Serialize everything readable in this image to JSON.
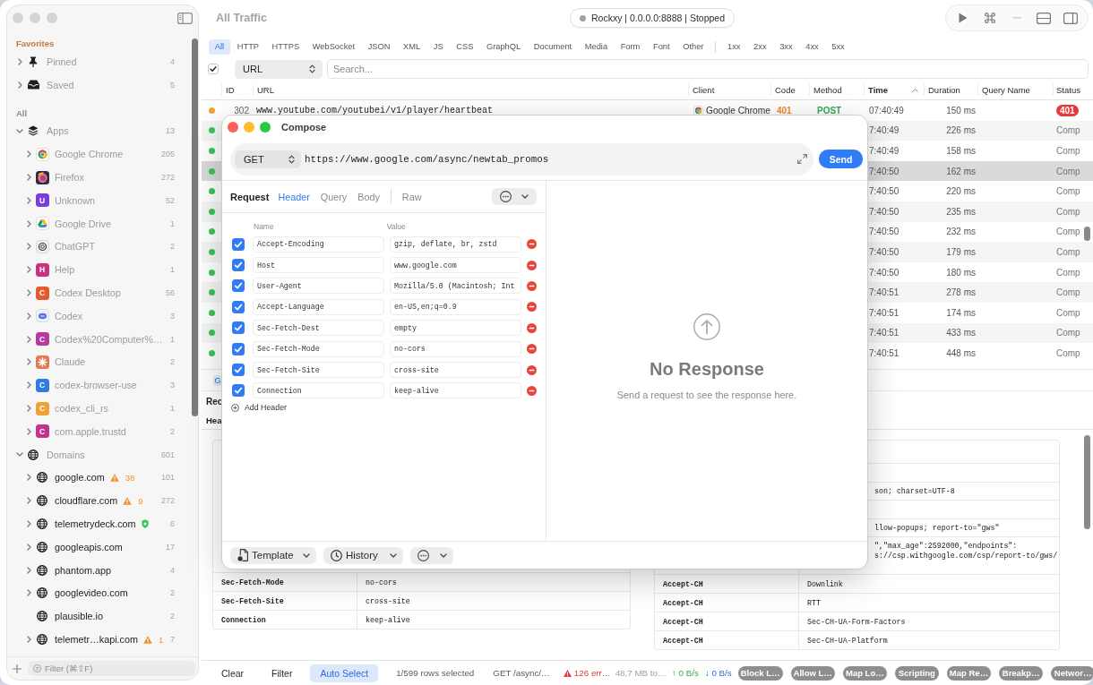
{
  "window": {
    "title": "All Traffic",
    "focused": false
  },
  "sidebar": {
    "sections": [
      {
        "title": "Favorites",
        "kind": "favorites",
        "items": [
          {
            "label": "Pinned",
            "count": "4",
            "kind": "pinned",
            "expanded": false
          },
          {
            "label": "Saved",
            "count": "5",
            "kind": "saved",
            "expanded": false
          }
        ]
      },
      {
        "title": "All",
        "kind": "all",
        "items": [
          {
            "label": "Apps",
            "count": "13",
            "kind": "apps",
            "expanded": true,
            "children": [
              {
                "label": "Google Chrome",
                "count": "205",
                "kind": "ring-logo",
                "expanded": false
              },
              {
                "label": "Firefox",
                "count": "272",
                "kind": "disc-logo",
                "expanded": false
              },
              {
                "label": "Unknown",
                "count": "52",
                "kind": "letter",
                "letter": "U",
                "color": "#7b3dd8",
                "expanded": false
              },
              {
                "label": "Google Drive",
                "count": "1",
                "kind": "triangle-logo",
                "expanded": false
              },
              {
                "label": "ChatGPT",
                "count": "2",
                "kind": "rings-logo",
                "expanded": false
              },
              {
                "label": "Help",
                "count": "1",
                "kind": "letter",
                "letter": "H",
                "color": "#c8327f",
                "expanded": false
              },
              {
                "label": "Codex Desktop",
                "count": "56",
                "kind": "letter",
                "letter": "C",
                "color": "#e5592c",
                "expanded": false
              },
              {
                "label": "Codex",
                "count": "3",
                "kind": "cloud-logo",
                "expanded": false
              },
              {
                "label": "Codex%20Computer%…",
                "count": "1",
                "kind": "letter",
                "letter": "C",
                "color": "#b8389f",
                "expanded": false
              },
              {
                "label": "Claude",
                "count": "2",
                "kind": "burst-logo",
                "expanded": false
              },
              {
                "label": "codex-browser-use",
                "count": "3",
                "kind": "letter",
                "letter": "C",
                "color": "#2f7ae3",
                "expanded": false
              },
              {
                "label": "codex_cli_rs",
                "count": "1",
                "kind": "letter",
                "letter": "C",
                "color": "#eea236",
                "expanded": false
              },
              {
                "label": "com.apple.trustd",
                "count": "2",
                "kind": "letter",
                "letter": "C",
                "color": "#c2338f",
                "expanded": false
              }
            ]
          },
          {
            "label": "Domains",
            "count": "601",
            "kind": "domains",
            "expanded": true,
            "children": [
              {
                "label": "google.com",
                "count": "101",
                "kind": "domain",
                "expanded": false,
                "alert": {
                  "kind": "warning",
                  "count": "38"
                }
              },
              {
                "label": "cloudflare.com",
                "count": "272",
                "kind": "domain",
                "expanded": false,
                "alert": {
                  "kind": "warning",
                  "count": "9"
                }
              },
              {
                "label": "telemetrydeck.com",
                "count": "6",
                "kind": "domain",
                "expanded": false,
                "alert": {
                  "kind": "shield"
                }
              },
              {
                "label": "googleapis.com",
                "count": "17",
                "kind": "domain",
                "expanded": false
              },
              {
                "label": "phantom.app",
                "count": "4",
                "kind": "domain",
                "expanded": false
              },
              {
                "label": "googlevideo.com",
                "count": "2",
                "kind": "domain",
                "expanded": false
              },
              {
                "label": "plausible.io",
                "count": "2",
                "kind": "domain"
              },
              {
                "label": "telemetr…kapi.com",
                "count": "7",
                "kind": "domain",
                "expanded": false,
                "alert": {
                  "kind": "warning",
                  "count": "1"
                }
              }
            ]
          }
        ]
      }
    ],
    "filter": {
      "placeholder": "Filter (⌘⇧F)"
    }
  },
  "proxy": {
    "text": "Rockxy | 0.0.0.0:8888 | Stopped",
    "running": false
  },
  "toolbar_actions": [
    {
      "kind": "play",
      "disabled": false
    },
    {
      "kind": "command",
      "disabled": false
    },
    {
      "kind": "minus",
      "disabled": true
    },
    {
      "kind": "split",
      "disabled": false
    },
    {
      "kind": "sidebar",
      "disabled": false
    }
  ],
  "type_filters": [
    {
      "label": "All",
      "selected": true
    },
    {
      "label": "HTTP",
      "selected": false
    },
    {
      "label": "HTTPS",
      "selected": false
    },
    {
      "label": "WebSocket",
      "selected": false
    },
    {
      "label": "JSON",
      "selected": false
    },
    {
      "label": "XML",
      "selected": false
    },
    {
      "label": "JS",
      "selected": false
    },
    {
      "label": "CSS",
      "selected": false
    },
    {
      "label": "GraphQL",
      "selected": false
    },
    {
      "label": "Document",
      "selected": false
    },
    {
      "label": "Media",
      "selected": false
    },
    {
      "label": "Form",
      "selected": false
    },
    {
      "label": "Font",
      "selected": false
    },
    {
      "label": "Other",
      "selected": false
    }
  ],
  "status_filters": [
    {
      "label": "1xx",
      "selected": false
    },
    {
      "label": "2xx",
      "selected": false
    },
    {
      "label": "3xx",
      "selected": false
    },
    {
      "label": "4xx",
      "selected": false
    },
    {
      "label": "5xx",
      "selected": false
    }
  ],
  "search": {
    "checked": true,
    "field": "URL",
    "placeholder": "Search..."
  },
  "table": {
    "columns": [
      {
        "label": "ID",
        "sorted": false
      },
      {
        "label": "URL",
        "sorted": false
      },
      {
        "label": "Client",
        "sorted": false
      },
      {
        "label": "Code",
        "sorted": false
      },
      {
        "label": "Method",
        "sorted": false
      },
      {
        "label": "Time",
        "sorted": true
      },
      {
        "label": "Duration",
        "sorted": false
      },
      {
        "label": "Query Name",
        "sorted": false
      },
      {
        "label": "Status",
        "sorted": false
      }
    ],
    "rows": [
      {
        "color": "#f5a13a",
        "id": "302",
        "url": "www.youtube.com/youtubei/v1/player/heartbeat",
        "client": "Google Chrome",
        "code": "401",
        "method": "POST",
        "time": "07:40:49",
        "duration": "150 ms",
        "status": "401",
        "kind": "error",
        "selected": false
      },
      {
        "color": "#3cc35a",
        "time": "7:40:49",
        "duration": "226 ms",
        "status": "Comp",
        "kind": "complete",
        "selected": false
      },
      {
        "color": "#3cc35a",
        "time": "7:40:49",
        "duration": "158 ms",
        "status": "Comp",
        "kind": "complete",
        "selected": false
      },
      {
        "color": "#3cc35a",
        "time": "7:40:50",
        "duration": "162 ms",
        "status": "Comp",
        "kind": "complete",
        "selected": true
      },
      {
        "color": "#3cc35a",
        "time": "7:40:50",
        "duration": "220 ms",
        "status": "Comp",
        "kind": "complete",
        "selected": false
      },
      {
        "color": "#3cc35a",
        "time": "7:40:50",
        "duration": "235 ms",
        "status": "Comp",
        "kind": "complete",
        "selected": false
      },
      {
        "color": "#3cc35a",
        "time": "7:40:50",
        "duration": "232 ms",
        "status": "Comp",
        "kind": "complete",
        "selected": false
      },
      {
        "color": "#3cc35a",
        "time": "7:40:50",
        "duration": "179 ms",
        "status": "Comp",
        "kind": "complete",
        "selected": false
      },
      {
        "color": "#3cc35a",
        "time": "7:40:50",
        "duration": "180 ms",
        "status": "Comp",
        "kind": "complete",
        "selected": false
      },
      {
        "color": "#3cc35a",
        "time": "7:40:51",
        "duration": "278 ms",
        "status": "Comp",
        "kind": "complete",
        "selected": false
      },
      {
        "color": "#3cc35a",
        "time": "7:40:51",
        "duration": "174 ms",
        "status": "Comp",
        "kind": "complete",
        "selected": false
      },
      {
        "color": "#3cc35a",
        "time": "7:40:51",
        "duration": "433 ms",
        "status": "Comp",
        "kind": "complete",
        "selected": false
      },
      {
        "color": "#3cc35a",
        "time": "7:40:51",
        "duration": "448 ms",
        "status": "Comp",
        "kind": "complete",
        "selected": false
      }
    ]
  },
  "detail": {
    "method": "G",
    "title": "Rec",
    "tab": "Hea",
    "request_headers": [
      {
        "name": "Sec-Fetch-Mode",
        "value": "no-cors"
      },
      {
        "name": "Sec-Fetch-Site",
        "value": "cross-site"
      },
      {
        "name": "Connection",
        "value": "keep-alive"
      }
    ],
    "response_headers": [
      {
        "value": "son; charset=UTF-8"
      },
      {
        "value": "llow-popups; report-to=\"gws\""
      },
      {
        "lines": [
          "\",\"max_age\":2592000,\"endpoints\":",
          "s://csp.withgoogle.com/csp/report-to/gws/"
        ]
      },
      {
        "name": "Accept-CH",
        "value": "Downlink"
      },
      {
        "name": "Accept-CH",
        "value": "RTT"
      },
      {
        "name": "Accept-CH",
        "value": "Sec-CH-UA-Form-Factors"
      },
      {
        "name": "Accept-CH",
        "value": "Sec-CH-UA-Platform"
      }
    ]
  },
  "compose": {
    "title": "Compose",
    "focused": true,
    "method": "GET",
    "url": "https://www.google.com/async/newtab_promos",
    "send": "Send",
    "section": "Request",
    "tabs": [
      {
        "label": "Header",
        "selected": true
      },
      {
        "label": "Query",
        "selected": false
      },
      {
        "label": "Body",
        "selected": false
      },
      {
        "label": "Raw",
        "selected": false
      }
    ],
    "columns": [
      "Name",
      "Value"
    ],
    "headers": [
      {
        "name": "Accept-Encoding",
        "value": "gzip, deflate, br, zstd",
        "checked": true
      },
      {
        "name": "Host",
        "value": "www.google.com",
        "checked": true
      },
      {
        "name": "User-Agent",
        "value": "Mozilla/5.0 (Macintosh; Int",
        "checked": true
      },
      {
        "name": "Accept-Language",
        "value": "en-US,en;q=0.9",
        "checked": true
      },
      {
        "name": "Sec-Fetch-Dest",
        "value": "empty",
        "checked": true
      },
      {
        "name": "Sec-Fetch-Mode",
        "value": "no-cors",
        "checked": true
      },
      {
        "name": "Sec-Fetch-Site",
        "value": "cross-site",
        "checked": true
      },
      {
        "name": "Connection",
        "value": "keep-alive",
        "checked": true
      }
    ],
    "add_header": "Add Header",
    "footer": [
      {
        "kind": "template",
        "label": "Template"
      },
      {
        "kind": "history",
        "label": "History"
      },
      {
        "kind": "more"
      }
    ],
    "response": {
      "title": "No Response",
      "message": "Send a request to see the response here."
    }
  },
  "status_bar": {
    "buttons": [
      {
        "label": "Clear",
        "selected": false
      },
      {
        "label": "Filter",
        "selected": false
      },
      {
        "label": "Auto Select",
        "selected": true
      }
    ],
    "selection": "1/599 rows selected",
    "request": "GET /async/…",
    "errors": "126 err…",
    "size": "48,7 MB to…",
    "upload": "↑ 0 B/s",
    "download": "↓ 0 B/s",
    "tools": [
      {
        "label": "Block L…",
        "on": false
      },
      {
        "label": "Allow L…",
        "on": false
      },
      {
        "label": "Map Lo…",
        "on": false
      },
      {
        "label": "Scripting",
        "on": false
      },
      {
        "label": "Map Re…",
        "on": false
      },
      {
        "label": "Breakp…",
        "on": false
      },
      {
        "label": "Networ…",
        "on": false
      }
    ]
  }
}
